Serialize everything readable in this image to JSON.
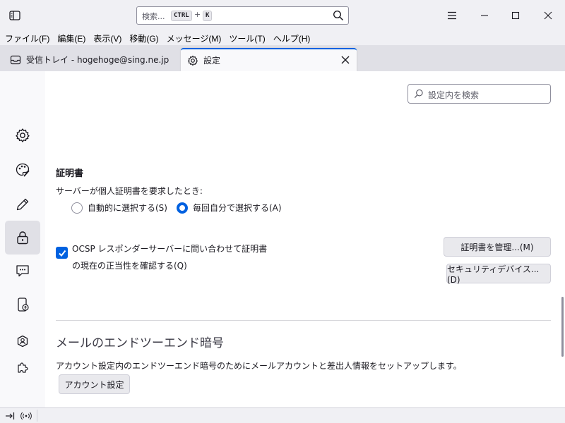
{
  "search": {
    "placeholder": "検索...",
    "shortcut_key1": "CTRL",
    "shortcut_plus": "+",
    "shortcut_key2": "K"
  },
  "menubar": [
    "ファイル(F)",
    "編集(E)",
    "表示(V)",
    "移動(G)",
    "メッセージ(M)",
    "ツール(T)",
    "ヘルプ(H)"
  ],
  "tabs": [
    {
      "label": "受信トレイ - hogehoge@sing.ne.jp",
      "icon": "inbox-icon"
    },
    {
      "label": "設定",
      "icon": "gear-icon",
      "active": true
    }
  ],
  "sidebar": {
    "items": [
      {
        "name": "general",
        "icon": "gear-icon"
      },
      {
        "name": "composition",
        "icon": "palette-icon"
      },
      {
        "name": "editing",
        "icon": "pencil-icon"
      },
      {
        "name": "privacy-security",
        "icon": "lock-icon",
        "selected": true
      },
      {
        "name": "chat",
        "icon": "chat-icon"
      },
      {
        "name": "sync",
        "icon": "sync-device-icon"
      },
      {
        "name": "account",
        "icon": "account-icon"
      },
      {
        "name": "addons",
        "icon": "puzzle-icon"
      }
    ]
  },
  "prefs_search": {
    "placeholder": "設定内を検索"
  },
  "certificates": {
    "title": "証明書",
    "question": "サーバーが個人証明書を要求したとき:",
    "radio_auto": "自動的に選択する(S)",
    "radio_ask": "毎回自分で選択する(A)",
    "selected_option": "ask",
    "ocsp_label": "OCSP レスポンダーサーバーに問い合わせて証明書の現在の正当性を確認する(Q)",
    "ocsp_checked": true,
    "manage_button": "証明書を管理...(M)",
    "devices_button": "セキュリティデバイス...(D)"
  },
  "e2e": {
    "title": "メールのエンドツーエンド暗号",
    "description": "アカウント設定内のエンドツーエンド暗号のためにメールアカウントと差出人情報をセットアップします。",
    "account_button": "アカウント設定"
  },
  "colors": {
    "accent": "#0061e0",
    "tabstrip": "#e0e0e6",
    "chrome": "#f0f0f4"
  }
}
